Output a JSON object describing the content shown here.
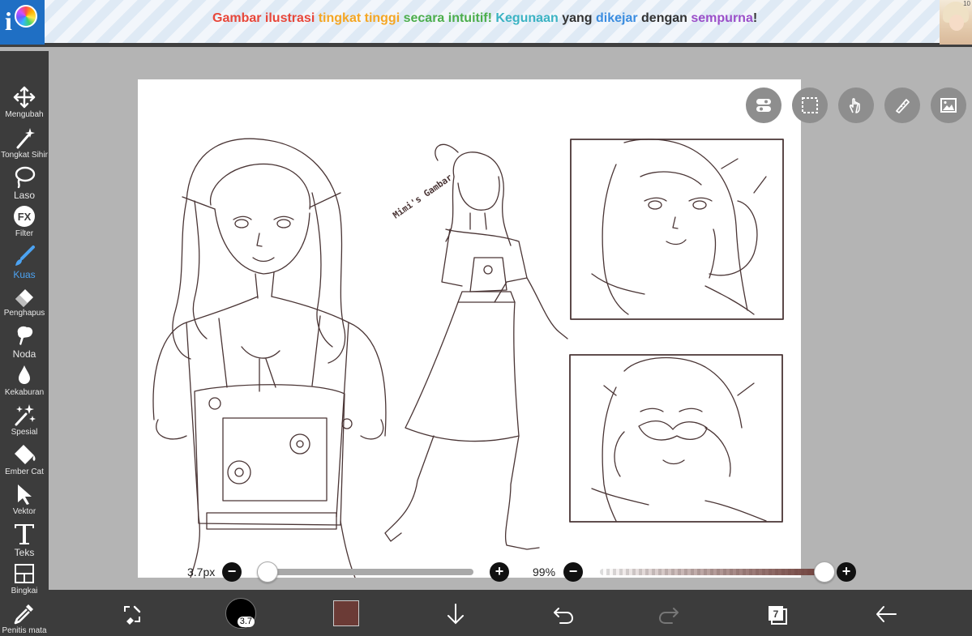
{
  "banner": {
    "segments": [
      {
        "text": "Gambar ilustrasi ",
        "color": "#e8473a"
      },
      {
        "text": "tingkat tinggi ",
        "color": "#f5a623"
      },
      {
        "text": "secara intuitif! ",
        "color": "#4cae4c"
      },
      {
        "text": "Kegunaan ",
        "color": "#3bb3c3"
      },
      {
        "text": "yang ",
        "color": "#333333"
      },
      {
        "text": "dikejar ",
        "color": "#3b8de0"
      },
      {
        "text": "dengan ",
        "color": "#333333"
      },
      {
        "text": "sempurna",
        "color": "#9b4fc9"
      },
      {
        "text": "!",
        "color": "#333333"
      }
    ],
    "status_time": "10"
  },
  "tools": [
    {
      "label": "Mengubah",
      "icon": "move-icon"
    },
    {
      "label": "Tongkat Sihir",
      "icon": "magic-wand-icon"
    },
    {
      "label": "Laso",
      "icon": "lasso-icon"
    },
    {
      "label": "Filter",
      "icon": "fx-icon"
    },
    {
      "label": "Kuas",
      "icon": "brush-icon"
    },
    {
      "label": "Penghapus",
      "icon": "eraser-icon"
    },
    {
      "label": "Noda",
      "icon": "smudge-icon"
    },
    {
      "label": "Kekaburan",
      "icon": "blur-drop-icon"
    },
    {
      "label": "Spesial",
      "icon": "special-sparkle-icon"
    },
    {
      "label": "Ember Cat",
      "icon": "paint-bucket-icon"
    },
    {
      "label": "Vektor",
      "icon": "vector-cursor-icon"
    },
    {
      "label": "Teks",
      "icon": "text-icon"
    },
    {
      "label": "Bingkai",
      "icon": "frame-icon"
    },
    {
      "label": "Penitis mata",
      "icon": "eyedropper-icon"
    }
  ],
  "active_tool": "Kuas",
  "artwork": {
    "signature": "Mimi's Gambar"
  },
  "sliders": {
    "brush_size": {
      "text": "3.7px",
      "value": 0.0
    },
    "opacity": {
      "text": "99%",
      "value": 0.99
    }
  },
  "bottom": {
    "brush_badge": "3.7",
    "color_swatch": "#6b3b36",
    "layer_count": "7"
  },
  "colors": {
    "active": "#4ca3f2",
    "toolbar_bg": "#3c3c3c",
    "canvas_bg": "#b4b4b4",
    "line_art": "#4a3535"
  }
}
